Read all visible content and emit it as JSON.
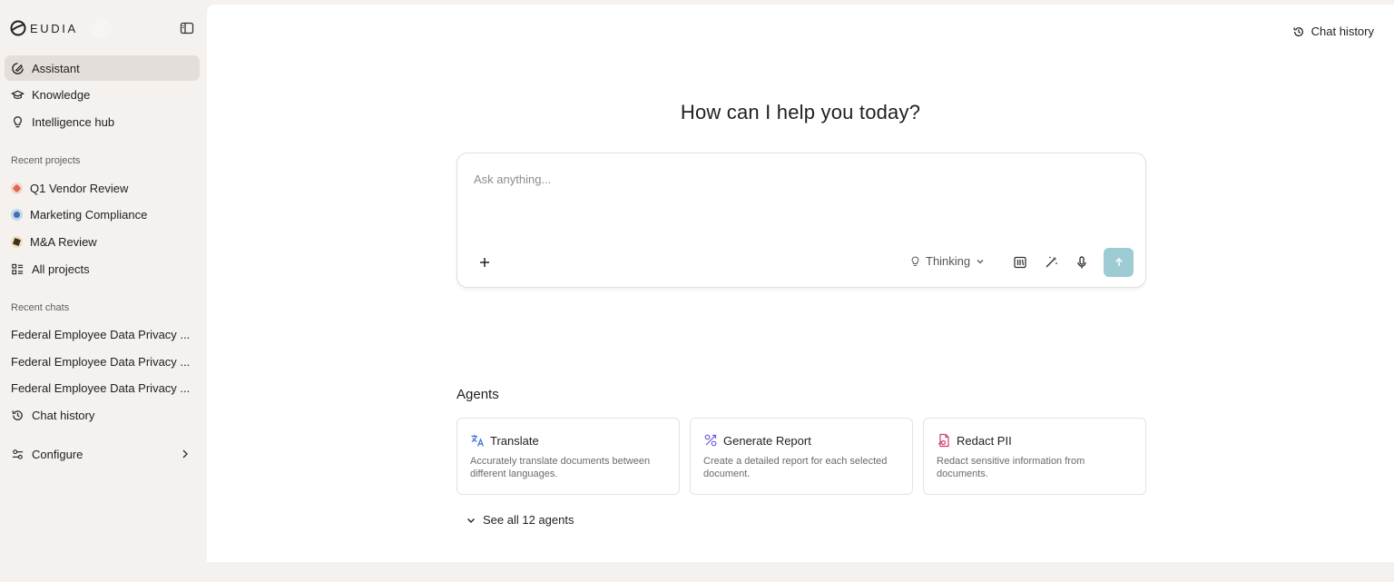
{
  "brand": {
    "name": "EUDIA"
  },
  "nav": [
    {
      "label": "Assistant",
      "icon": "assistant-icon",
      "active": true
    },
    {
      "label": "Knowledge",
      "icon": "graduation-cap-icon",
      "active": false
    },
    {
      "label": "Intelligence hub",
      "icon": "lightbulb-icon",
      "active": false
    }
  ],
  "recent_projects": {
    "heading": "Recent projects",
    "items": [
      {
        "label": "Q1 Vendor Review",
        "color": "#e06a4f"
      },
      {
        "label": "Marketing Compliance",
        "color": "#3f6fb5"
      },
      {
        "label": "M&A Review",
        "color": "#d9a23a"
      }
    ],
    "all_label": "All projects"
  },
  "recent_chats": {
    "heading": "Recent chats",
    "items": [
      {
        "label": "Federal Employee Data Privacy ..."
      },
      {
        "label": "Federal Employee Data Privacy ..."
      },
      {
        "label": "Federal Employee Data Privacy ..."
      }
    ],
    "history_label": "Chat history"
  },
  "configure_label": "Configure",
  "header": {
    "chat_history_label": "Chat history"
  },
  "main": {
    "greeting": "How can I help you today?",
    "composer": {
      "placeholder": "Ask anything...",
      "value": "",
      "mode_label": "Thinking",
      "send_color": "#9ccbd3"
    },
    "agents_title": "Agents",
    "agents": [
      {
        "title": "Translate",
        "description": "Accurately translate documents between different languages.",
        "icon": "translate-icon",
        "color": "#3b6fd8"
      },
      {
        "title": "Generate Report",
        "description": "Create a detailed report for each selected document.",
        "icon": "report-icon",
        "color": "#6b5bd6"
      },
      {
        "title": "Redact PII",
        "description": "Redact sensitive information from documents.",
        "icon": "redact-icon",
        "color": "#d43d6a"
      }
    ],
    "see_all_label": "See all 12 agents"
  }
}
